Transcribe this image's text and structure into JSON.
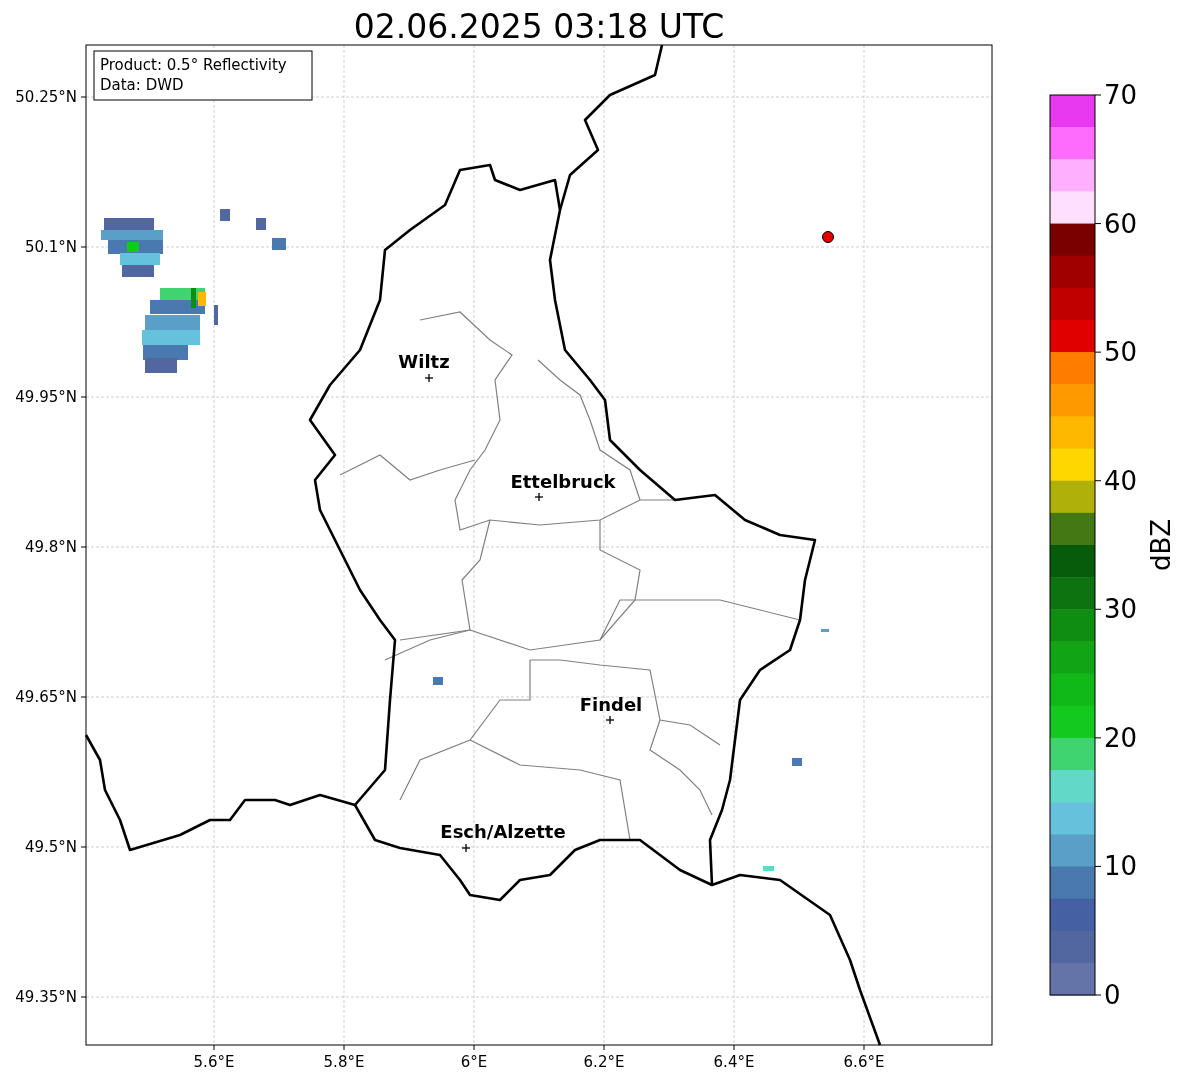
{
  "title": "02.06.2025 03:18 UTC",
  "legend": [
    "Product: 0.5° Reflectivity",
    "Data: DWD"
  ],
  "y_ticks": [
    "50.25°N",
    "50.1°N",
    "49.95°N",
    "49.8°N",
    "49.65°N",
    "49.5°N",
    "49.35°N"
  ],
  "x_ticks": [
    "5.6°E",
    "5.8°E",
    "6°E",
    "6.2°E",
    "6.4°E",
    "6.6°E"
  ],
  "cities": [
    {
      "name": "Wiltz"
    },
    {
      "name": "Ettelbruck"
    },
    {
      "name": "Findel"
    },
    {
      "name": "Esch/Alzette"
    }
  ],
  "colorbar": {
    "label": "dBZ",
    "ticks": [
      "70",
      "60",
      "50",
      "40",
      "30",
      "20",
      "10",
      "0"
    ],
    "segments": [
      {
        "color": "#e838f0"
      },
      {
        "color": "#fe6cfe"
      },
      {
        "color": "#feb0fe"
      },
      {
        "color": "#fee0fe"
      },
      {
        "color": "#7a0000"
      },
      {
        "color": "#a00000"
      },
      {
        "color": "#c00000"
      },
      {
        "color": "#e00000"
      },
      {
        "color": "#fe7c00"
      },
      {
        "color": "#fe9a00"
      },
      {
        "color": "#feb800"
      },
      {
        "color": "#fed600"
      },
      {
        "color": "#b0b00a"
      },
      {
        "color": "#437814"
      },
      {
        "color": "#075c0c"
      },
      {
        "color": "#0c7310"
      },
      {
        "color": "#0f8c12"
      },
      {
        "color": "#11a516"
      },
      {
        "color": "#10b818"
      },
      {
        "color": "#13c81e"
      },
      {
        "color": "#3fd46f"
      },
      {
        "color": "#62d8c8"
      },
      {
        "color": "#65c1dc"
      },
      {
        "color": "#5a9fc8"
      },
      {
        "color": "#4a79b0"
      },
      {
        "color": "#4560a3"
      },
      {
        "color": "#5266a0"
      },
      {
        "color": "#6474a8"
      }
    ]
  }
}
